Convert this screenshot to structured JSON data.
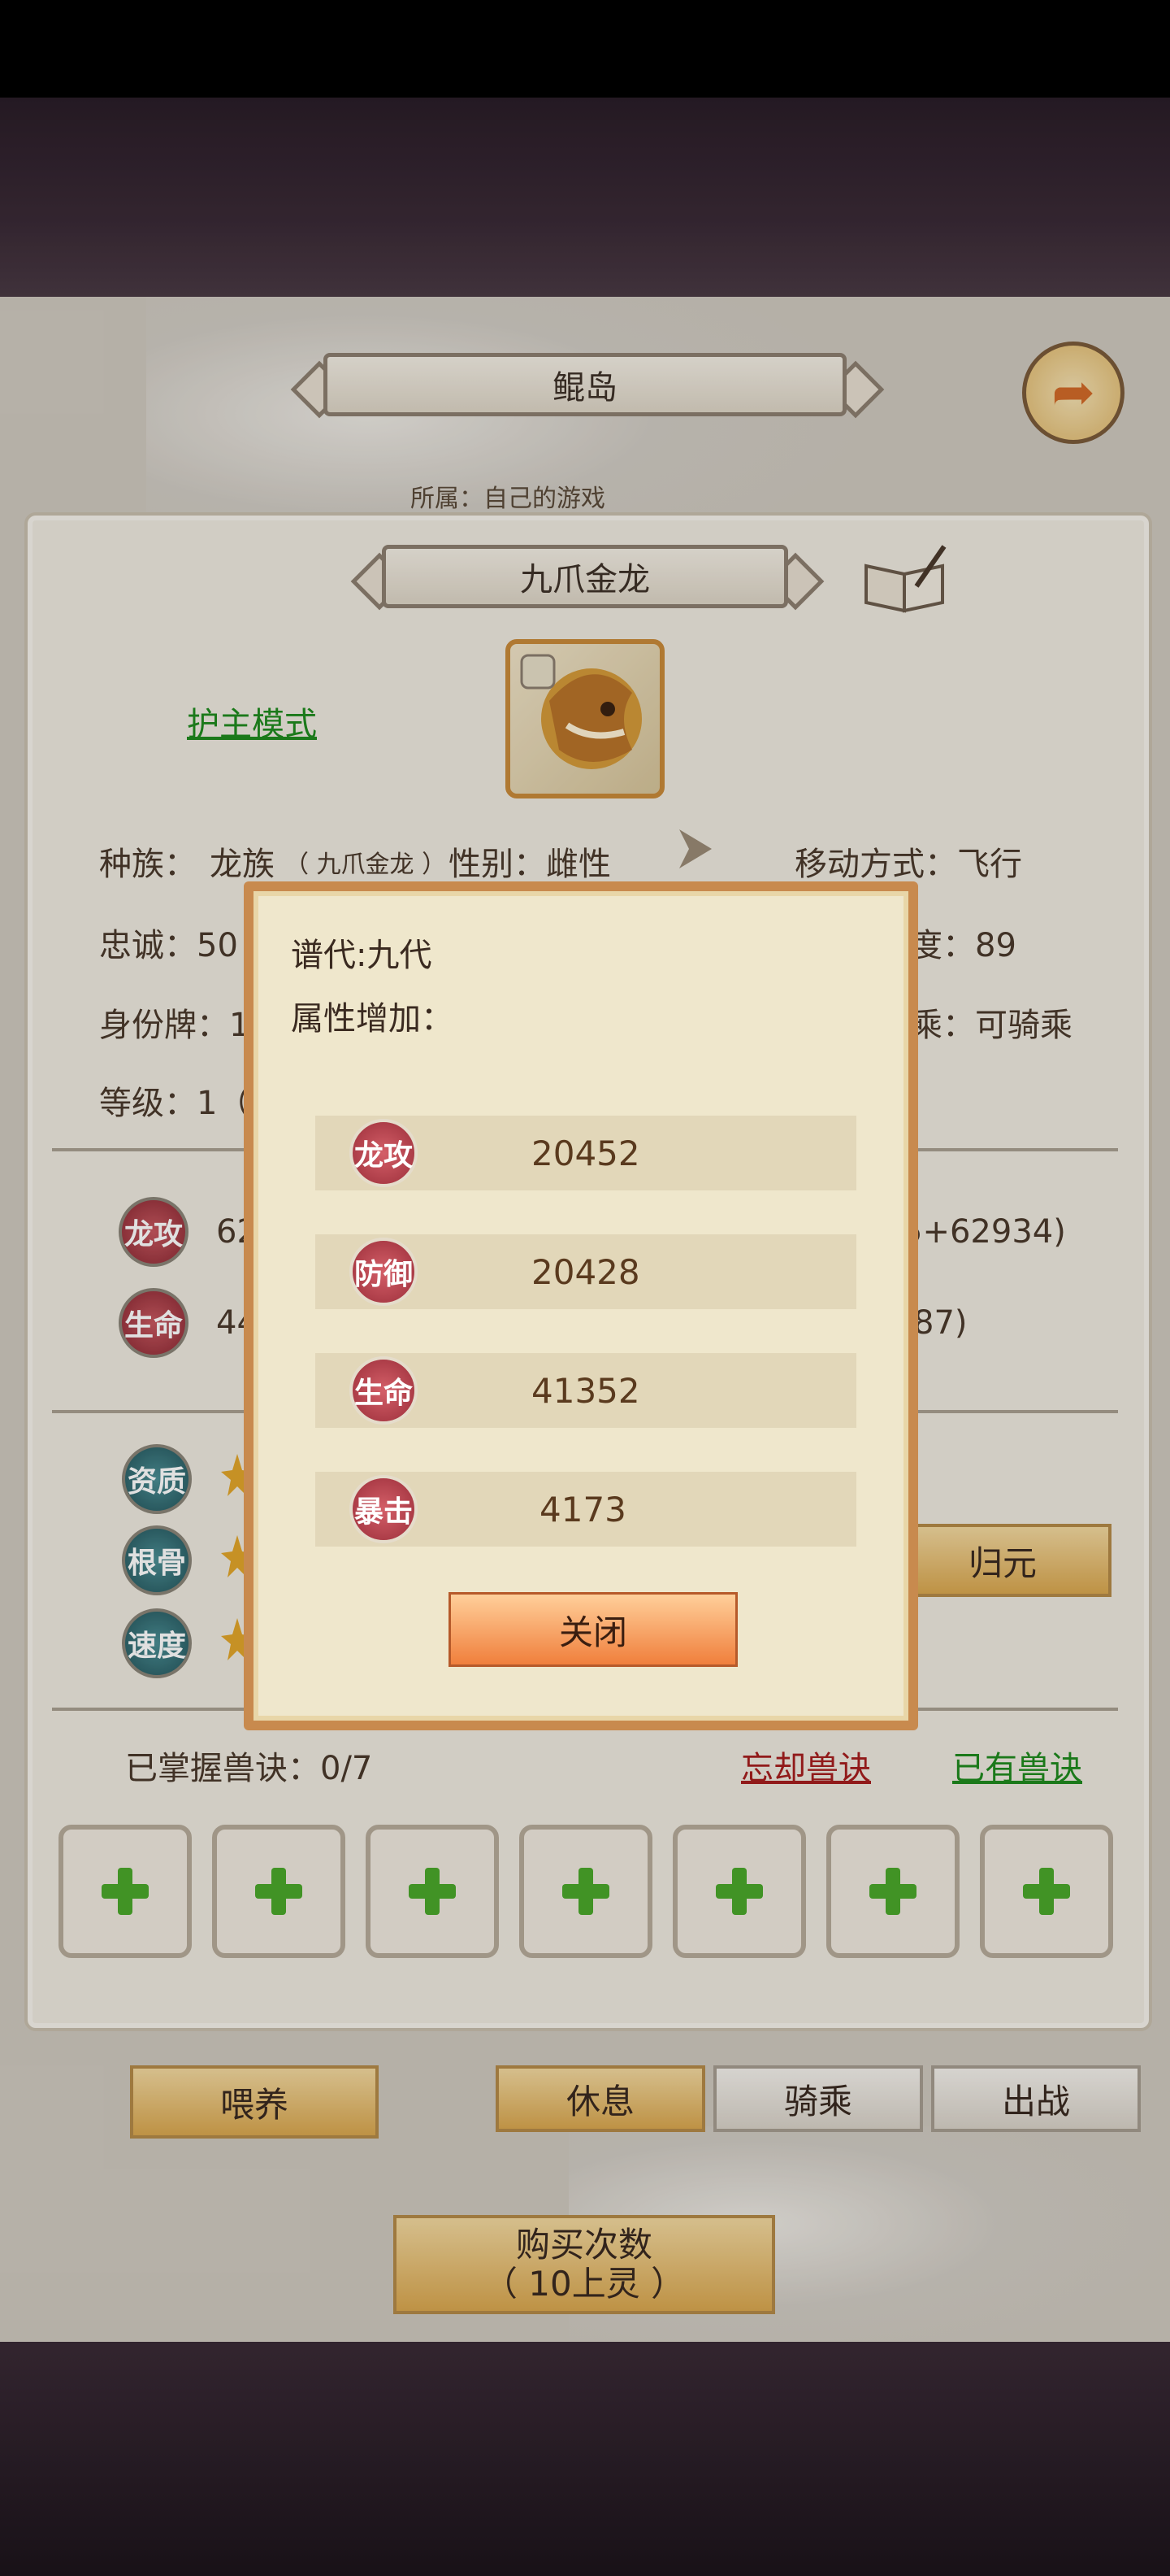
{
  "location": {
    "title": "鲲岛"
  },
  "pet": {
    "name": "九爪金龙",
    "guard_mode_link": "护主模式",
    "race_label": "种族：",
    "race_value": "龙族",
    "race_detail": "（ 九爪金龙 ）",
    "gender": "性别：雌性",
    "movement": "移动方式：飞行",
    "loyalty": "忠诚：50",
    "intimacy_partial": "度：89",
    "identity_partial": "身份牌：1",
    "ride_partial": "乘：可骑乘",
    "level_partial": "等级：1（",
    "hint_text": "所属：自己的游戏"
  },
  "stats": {
    "attack_label": "龙攻",
    "attack_partial_left": "62",
    "attack_partial_right": "5+62934)",
    "hp_label": "生命",
    "hp_partial_left": "44",
    "hp_partial_right": "87)"
  },
  "attributes": [
    {
      "label": "资质"
    },
    {
      "label": "根骨"
    },
    {
      "label": "速度"
    }
  ],
  "buttons": {
    "reset": "归元",
    "feed": "喂养",
    "rest": "休息",
    "ride": "骑乘",
    "battle": "出战",
    "buy_line1": "购买次数",
    "buy_line2": "（ 10上灵 ）"
  },
  "skills": {
    "mastered": "已掌握兽诀：0/7",
    "forget_link": "忘却兽诀",
    "owned_link": "已有兽诀",
    "slots": [
      "+",
      "+",
      "+",
      "+",
      "+",
      "+",
      "+"
    ]
  },
  "popup": {
    "generation": "谱代:九代",
    "bonus_title": "属性增加：",
    "rows": [
      {
        "label": "龙攻",
        "value": "20452"
      },
      {
        "label": "防御",
        "value": "20428"
      },
      {
        "label": "生命",
        "value": "41352"
      },
      {
        "label": "暴击",
        "value": "4173"
      }
    ],
    "close": "关闭"
  },
  "colors": {
    "link_green": "#1f8a1e",
    "link_red": "#a51e1e",
    "popup_border": "#c88a4e",
    "close_button": "#f07f3c"
  }
}
